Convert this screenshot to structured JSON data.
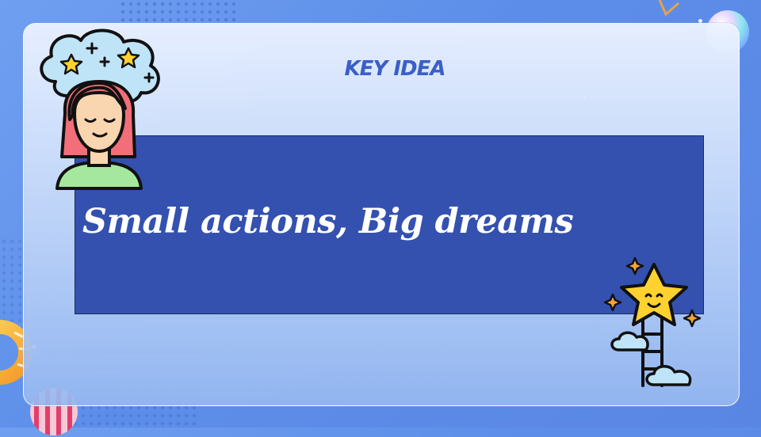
{
  "slide": {
    "label": "KEY IDEA",
    "headline": "Small actions, Big dreams"
  },
  "colors": {
    "background": "#6f9ff0",
    "banner": "#3451b0",
    "label": "#3b5fc7",
    "headline": "#ffffff"
  },
  "icons": [
    "dreaming-woman-icon",
    "star-ladder-icon",
    "star-icon",
    "cloud-icon",
    "sparkle-icon"
  ]
}
